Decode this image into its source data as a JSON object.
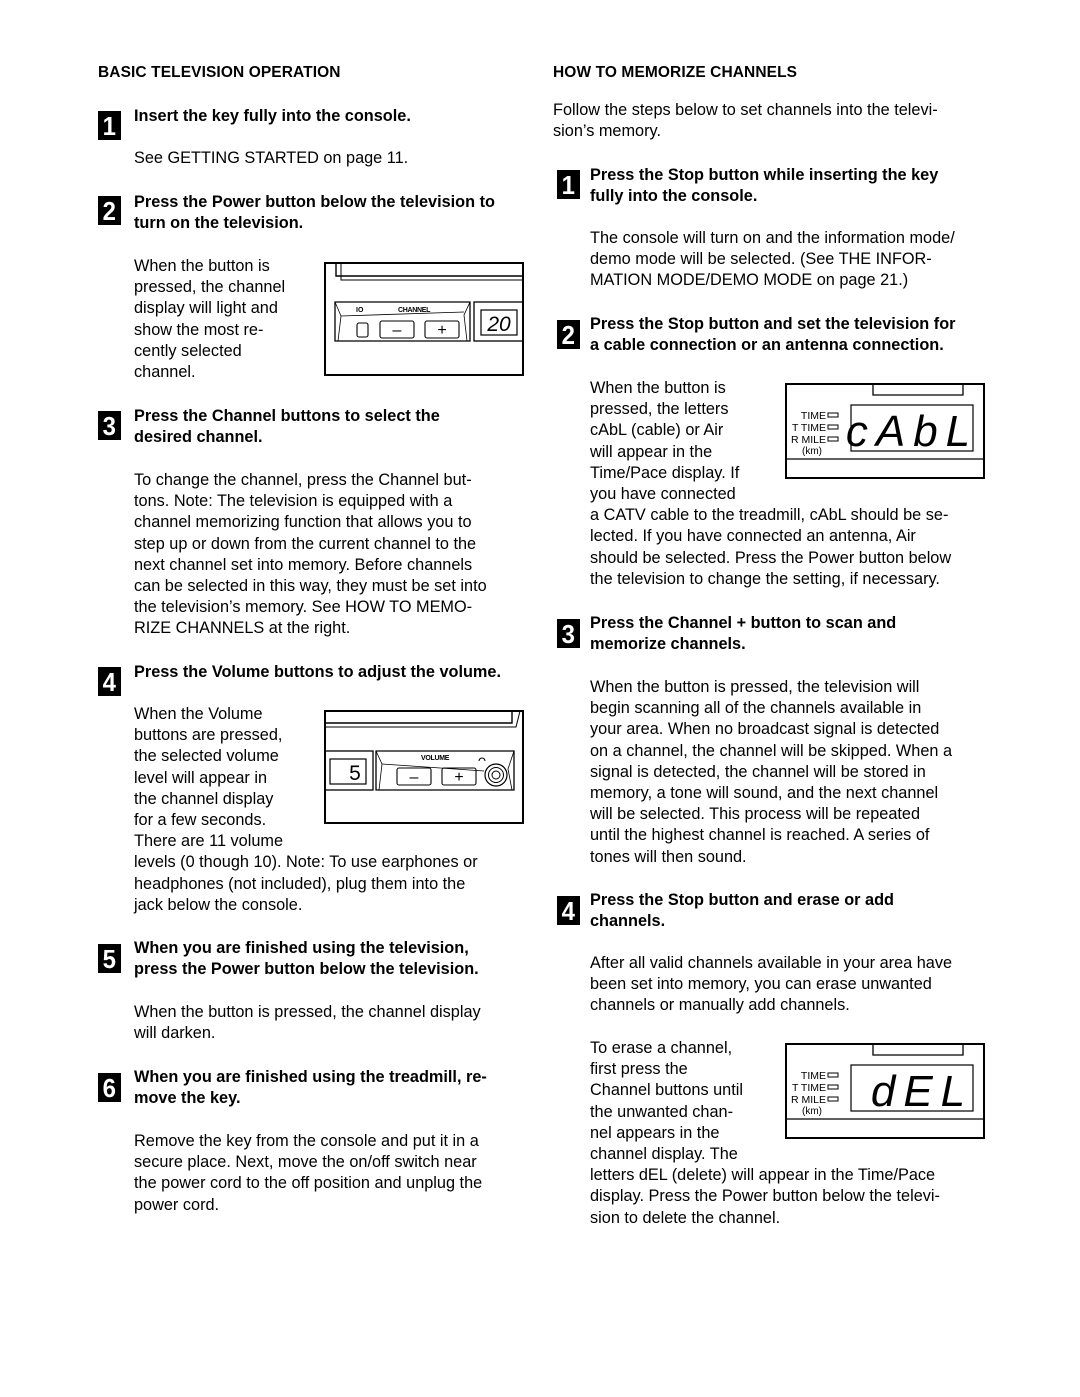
{
  "left": {
    "heading": "BASIC TELEVISION OPERATION",
    "steps": [
      {
        "number": "1",
        "title": [
          "Insert the key fully into the console."
        ],
        "body": [
          "See GETTING STARTED on page 11."
        ]
      },
      {
        "number": "2",
        "title": [
          "Press the Power button below the television to",
          "turn on the television."
        ],
        "body": [
          "When the button is",
          "pressed, the channel",
          "display will light and",
          "show the most re-",
          "cently selected",
          "channel."
        ]
      },
      {
        "number": "3",
        "title": [
          "Press the Channel buttons to select the",
          "desired channel."
        ],
        "body": [
          "To change the channel, press the Channel but-",
          "tons. Note: The television is equipped with a",
          "channel memorizing function that allows you to",
          "step up or down from the current channel to the",
          "next channel set into memory. Before channels",
          "can be selected in this way, they must be set into",
          "the television’s memory. See HOW TO MEMO-",
          "RIZE CHANNELS at the right."
        ]
      },
      {
        "number": "4",
        "title": [
          "Press the Volume buttons to adjust the volume."
        ],
        "body": [
          "When the Volume",
          "buttons are pressed,",
          "the selected volume",
          "level will appear in",
          "the channel display",
          "for a few seconds.",
          "There are 11 volume",
          "levels (0 though 10). Note: To use earphones or",
          "headphones (not included), plug them into the",
          "jack below the console."
        ]
      },
      {
        "number": "5",
        "title": [
          "When you are finished using the television,",
          "press the Power button below the television."
        ],
        "body": [
          "When the button is pressed, the channel display",
          "will darken."
        ]
      },
      {
        "number": "6",
        "title": [
          "When you are finished using the treadmill, re-",
          "move the key."
        ],
        "body": [
          "Remove the key from the console and put it in a",
          "secure place. Next, move the on/off switch near",
          "the power cord to the off position and unplug the",
          "power cord."
        ]
      }
    ],
    "channel_figure": {
      "power_label": "IO",
      "channel_label": "CHANNEL",
      "minus": "–",
      "plus": "+",
      "display": "20"
    },
    "volume_figure": {
      "volume_label": "VOLUME",
      "minus": "–",
      "plus": "+",
      "display": "5"
    }
  },
  "right": {
    "heading": "HOW TO MEMORIZE CHANNELS",
    "intro": [
      "Follow the steps below to set channels into the televi-",
      "sion’s memory."
    ],
    "steps": [
      {
        "number": "1",
        "title": [
          "Press the Stop button while inserting the key",
          "fully into the console."
        ],
        "body": [
          "The console will turn on and the information mode/",
          "demo mode will be selected. (See THE INFOR-",
          "MATION MODE/DEMO MODE on page 21.)"
        ]
      },
      {
        "number": "2",
        "title": [
          "Press the Stop button and set the television for",
          "a cable connection or an antenna connection."
        ],
        "body": [
          "When the button is",
          "pressed, the letters",
          "cAbL (cable) or Air",
          "will appear in the",
          "Time/Pace display. If",
          "you have connected",
          "a CATV cable to the treadmill, cAbL should be se-",
          "lected. If you have connected an antenna, Air",
          "should be selected. Press the Power button below",
          "the television to change the setting, if necessary."
        ]
      },
      {
        "number": "3",
        "title": [
          "Press the Channel + button to scan and",
          "memorize channels."
        ],
        "body": [
          "When the button is pressed, the television will",
          "begin scanning all of the channels available in",
          "your area. When no broadcast signal is detected",
          "on a channel, the channel will be skipped. When a",
          "signal is detected, the channel will be stored in",
          "memory, a tone will sound, and the next channel",
          "will be selected. This process will be repeated",
          "until the highest channel is reached. A series of",
          "tones will then sound."
        ]
      },
      {
        "number": "4",
        "title": [
          "Press the Stop button and erase or add",
          "channels."
        ],
        "body": [
          "After all valid channels available in your area have",
          "been set into memory, you can erase unwanted",
          "channels or manually add channels."
        ],
        "body2": [
          "To erase a channel,",
          "first press the",
          "Channel buttons until",
          "the unwanted chan-",
          "nel appears in the",
          "channel display. The",
          "letters dEL (delete) will appear in the Time/Pace",
          "display. Press the Power button below the televi-",
          "sion to delete the channel."
        ]
      }
    ],
    "display_labels": [
      "TIME",
      "T TIME",
      "R MILE",
      "(km)"
    ],
    "cable_display": "cAbL",
    "delete_display": "dEL"
  }
}
